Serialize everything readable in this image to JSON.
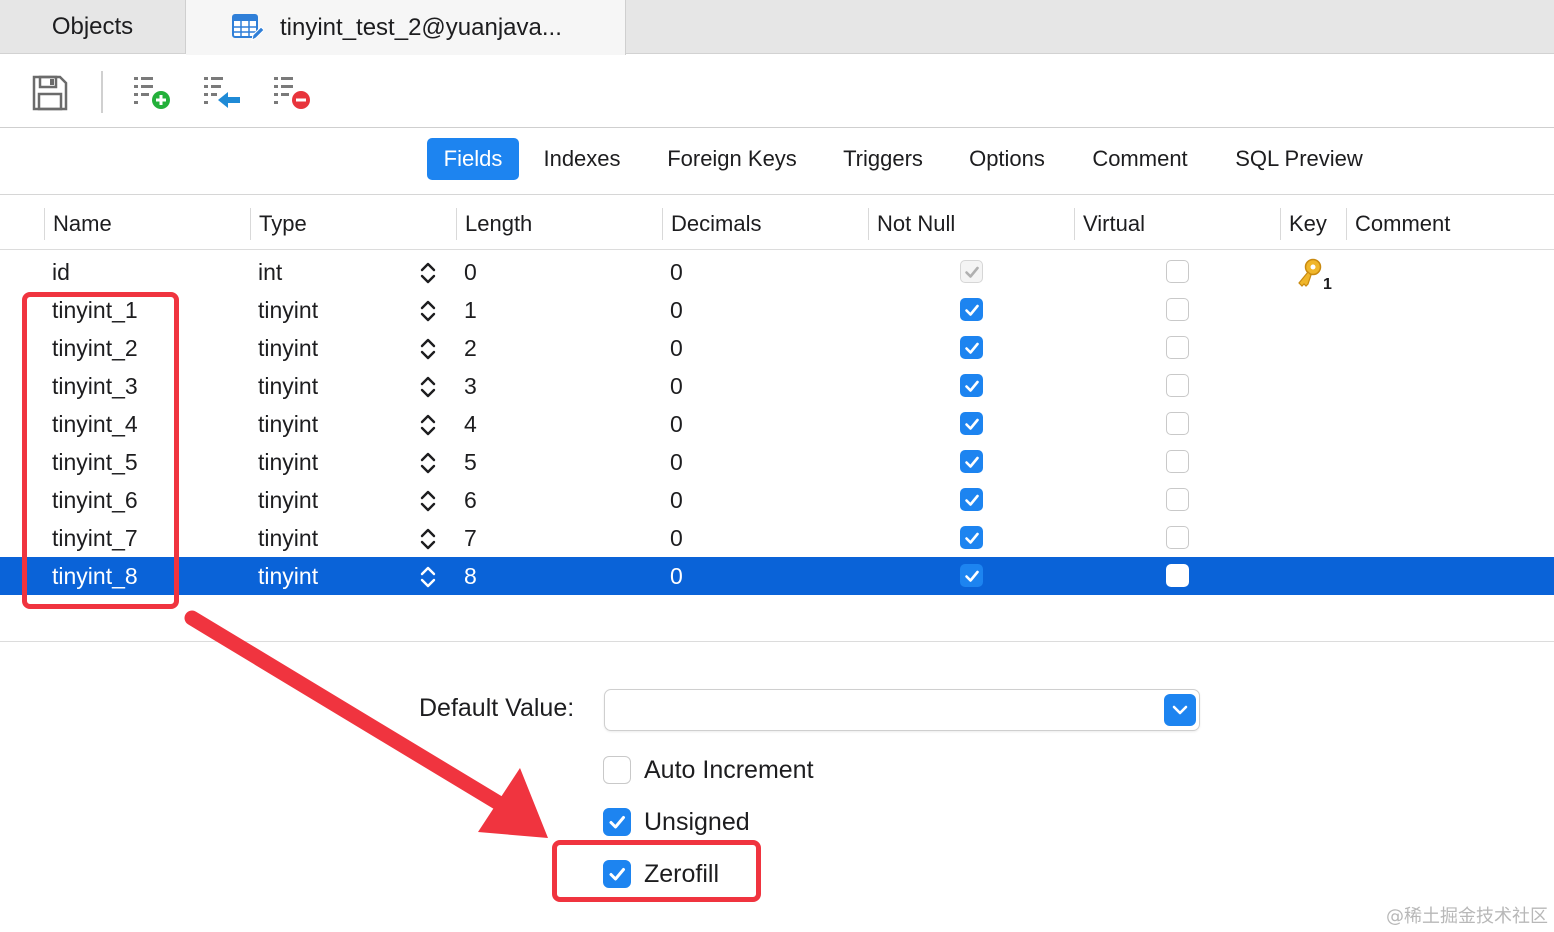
{
  "tabs": {
    "objects": "Objects",
    "table": "tinyint_test_2@yuanjava..."
  },
  "subtabs": [
    "Fields",
    "Indexes",
    "Foreign Keys",
    "Triggers",
    "Options",
    "Comment",
    "SQL Preview"
  ],
  "active_subtab": "Fields",
  "columns": [
    "Name",
    "Type",
    "Length",
    "Decimals",
    "Not Null",
    "Virtual",
    "Key",
    "Comment"
  ],
  "rows": [
    {
      "name": "id",
      "type": "int",
      "length": "0",
      "decimals": "0",
      "not_null": true,
      "virtual": false,
      "key": "1"
    },
    {
      "name": "tinyint_1",
      "type": "tinyint",
      "length": "1",
      "decimals": "0",
      "not_null": true,
      "virtual": false
    },
    {
      "name": "tinyint_2",
      "type": "tinyint",
      "length": "2",
      "decimals": "0",
      "not_null": true,
      "virtual": false
    },
    {
      "name": "tinyint_3",
      "type": "tinyint",
      "length": "3",
      "decimals": "0",
      "not_null": true,
      "virtual": false
    },
    {
      "name": "tinyint_4",
      "type": "tinyint",
      "length": "4",
      "decimals": "0",
      "not_null": true,
      "virtual": false
    },
    {
      "name": "tinyint_5",
      "type": "tinyint",
      "length": "5",
      "decimals": "0",
      "not_null": true,
      "virtual": false
    },
    {
      "name": "tinyint_6",
      "type": "tinyint",
      "length": "6",
      "decimals": "0",
      "not_null": true,
      "virtual": false
    },
    {
      "name": "tinyint_7",
      "type": "tinyint",
      "length": "7",
      "decimals": "0",
      "not_null": true,
      "virtual": false
    },
    {
      "name": "tinyint_8",
      "type": "tinyint",
      "length": "8",
      "decimals": "0",
      "not_null": true,
      "virtual": false,
      "selected": true
    }
  ],
  "properties": {
    "default_value_label": "Default Value:",
    "default_value": "",
    "auto_increment_label": "Auto Increment",
    "auto_increment": false,
    "unsigned_label": "Unsigned",
    "unsigned": true,
    "zerofill_label": "Zerofill",
    "zerofill": true
  },
  "watermark": "@稀土掘金技术社区",
  "colors": {
    "accent": "#1d84f0",
    "selection": "#0a63d8",
    "annotation": "#f0343f"
  }
}
